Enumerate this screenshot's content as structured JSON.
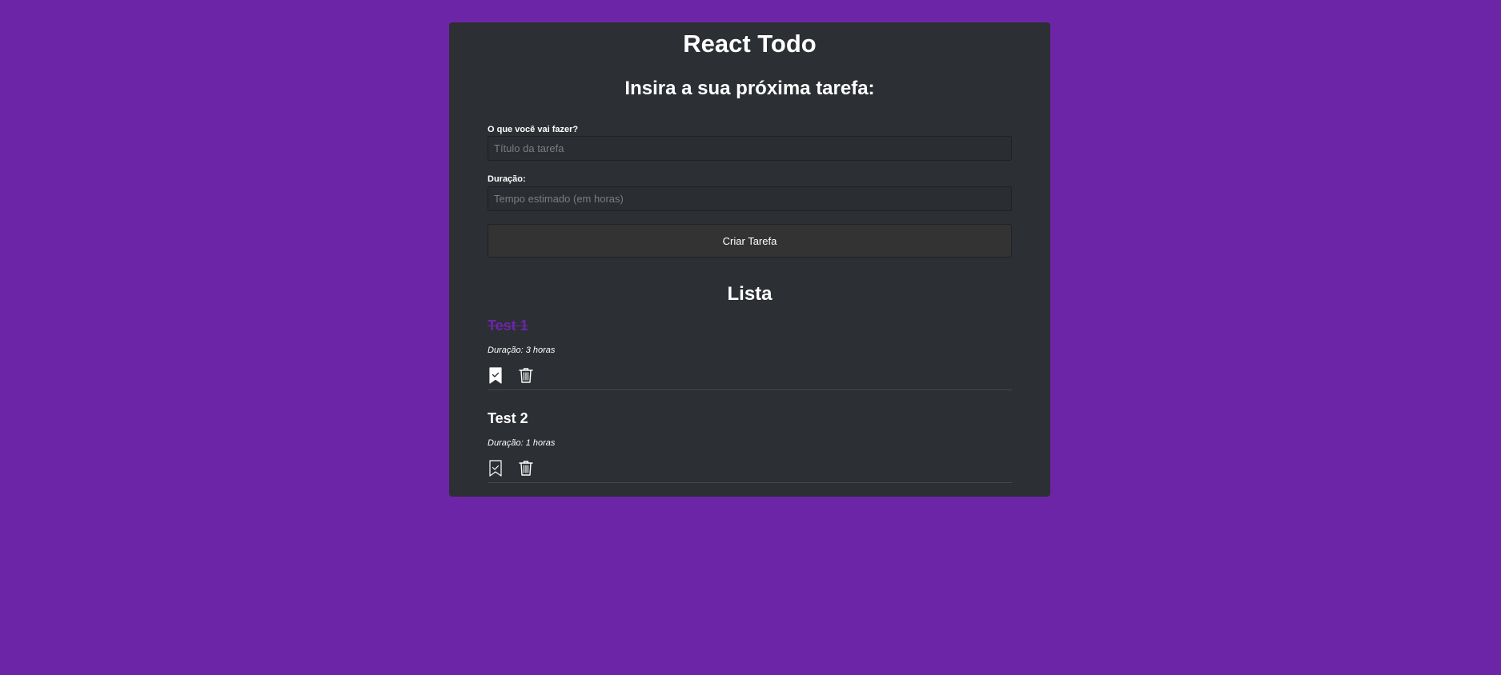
{
  "app": {
    "title": "React Todo"
  },
  "form": {
    "heading": "Insira a sua próxima tarefa:",
    "title_label": "O que você vai fazer?",
    "title_placeholder": "Título da tarefa",
    "duration_label": "Duração:",
    "duration_placeholder": "Tempo estimado (em horas)",
    "submit_label": "Criar Tarefa"
  },
  "list": {
    "heading": "Lista",
    "items": [
      {
        "title": "Test 1",
        "duration": "Duração: 3 horas",
        "done": true
      },
      {
        "title": "Test 2",
        "duration": "Duração: 1 horas",
        "done": false
      }
    ]
  },
  "colors": {
    "background": "#6d25a8",
    "panel": "#2c2f33",
    "done_text": "#6d25a8"
  },
  "icons": {
    "complete": "bookmark-check-icon",
    "delete": "trash-icon"
  }
}
